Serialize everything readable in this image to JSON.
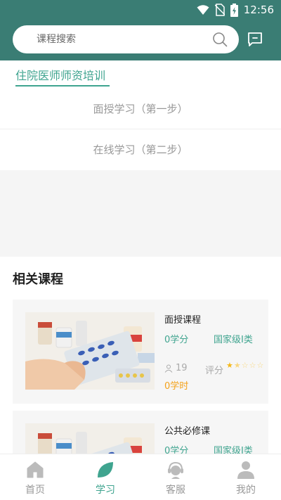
{
  "status_bar": {
    "time": "12:56"
  },
  "header": {
    "search_placeholder": "课程搜索"
  },
  "tabs": [
    {
      "label": "住院医师师资培训",
      "active": true
    }
  ],
  "steps": [
    {
      "label": "面授学习（第一步）"
    },
    {
      "label": "在线学习（第二步）"
    }
  ],
  "related": {
    "title": "相关课程",
    "courses": [
      {
        "name": "面授课程",
        "credit": "0学分",
        "level": "国家级I类",
        "people": "19",
        "rating_label": "评分",
        "rating": 1.5,
        "hours": "0学时"
      },
      {
        "name": "公共必修课",
        "credit": "0学分",
        "level": "国家级I类"
      }
    ]
  },
  "bottom_nav": [
    {
      "label": "首页",
      "icon": "home-icon",
      "active": false
    },
    {
      "label": "学习",
      "icon": "leaf-icon",
      "active": true
    },
    {
      "label": "客服",
      "icon": "support-agent-icon",
      "active": false
    },
    {
      "label": "我的",
      "icon": "user-icon",
      "active": false
    }
  ],
  "colors": {
    "primary": "#3a7d74",
    "accent": "#3fa48f",
    "hours": "#f4a21a",
    "star": "#f4b81a"
  }
}
